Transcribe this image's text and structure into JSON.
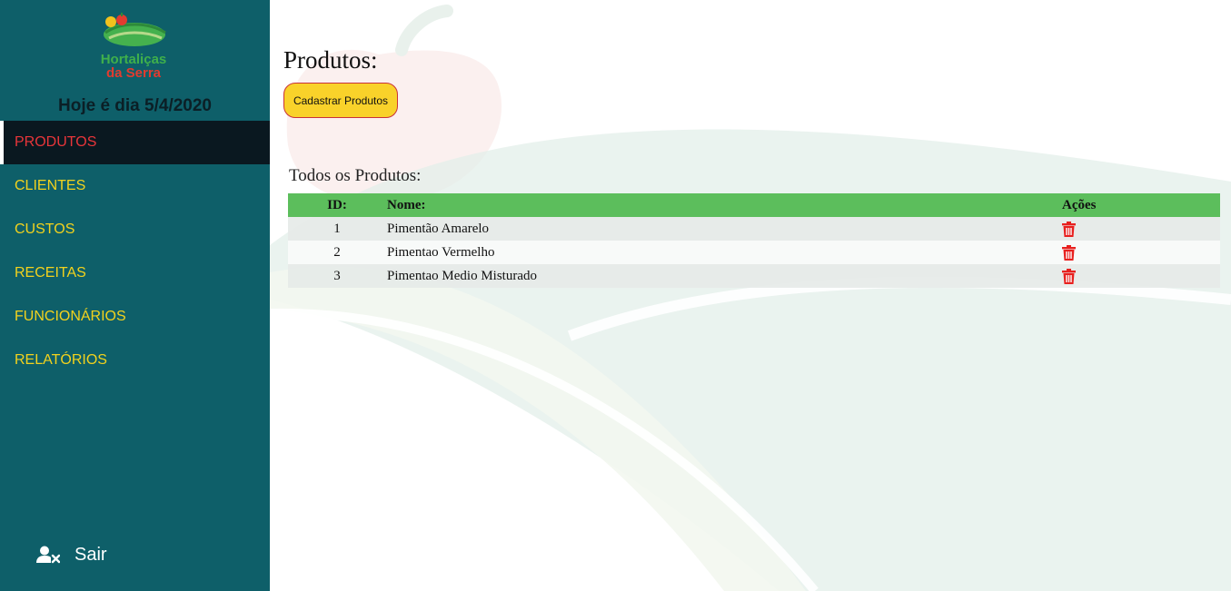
{
  "brand": {
    "line1": "Hortaliças",
    "line2": "da Serra"
  },
  "sidebar": {
    "date_text": "Hoje é dia 5/4/2020",
    "items": [
      {
        "label": "PRODUTOS",
        "active": true
      },
      {
        "label": "CLIENTES",
        "active": false
      },
      {
        "label": "CUSTOS",
        "active": false
      },
      {
        "label": "RECEITAS",
        "active": false
      },
      {
        "label": "FUNCIONÁRIOS",
        "active": false
      },
      {
        "label": "RELATÓRIOS",
        "active": false
      }
    ],
    "logout": {
      "label": "Sair",
      "icon": "user-remove-icon"
    }
  },
  "main": {
    "title": "Produtos:",
    "add_button": "Cadastrar Produtos",
    "list_title": "Todos os Produtos:",
    "table": {
      "headers": {
        "id": "ID:",
        "name": "Nome:",
        "actions": "Ações"
      },
      "rows": [
        {
          "id": "1",
          "name": "Pimentão Amarelo",
          "action_icon": "trash-icon"
        },
        {
          "id": "2",
          "name": "Pimentao Vermelho",
          "action_icon": "trash-icon"
        },
        {
          "id": "3",
          "name": "Pimentao Medio Misturado",
          "action_icon": "trash-icon"
        }
      ]
    }
  },
  "colors": {
    "sidebar_bg": "#0e5f69",
    "nav_text": "#f2d21d",
    "nav_active_text": "#e8353a",
    "nav_active_bg": "#0a1820",
    "table_header": "#5cbe5c",
    "button_bg": "#f9d22a",
    "trash": "#e8201e"
  }
}
